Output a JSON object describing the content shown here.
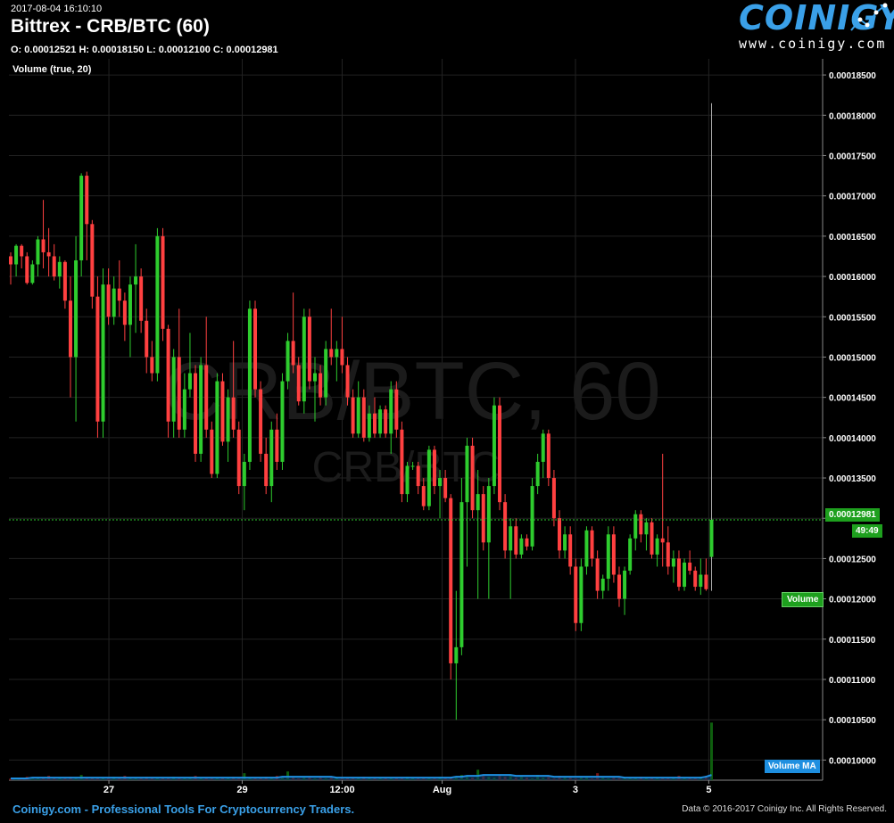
{
  "header": {
    "timestamp": "2017-08-04 16:10:10",
    "title": "Bittrex - CRB/BTC (60)",
    "ohlc": "O: 0.00012521 H: 0.00018150 L: 0.00012100 C: 0.00012981",
    "volume_label": "Volume (true, 20)"
  },
  "logo": {
    "word": "COINIGY",
    "url": "www.coinigy.com"
  },
  "watermark": {
    "line1": "CRB/BTC, 60",
    "line2": "CRB/BTC"
  },
  "badges": {
    "last_price": "0.00012981",
    "countdown": "49:49",
    "volume": "Volume",
    "volume_ma": "Volume MA"
  },
  "footer": {
    "left": "Coinigy.com - Professional Tools For Cryptocurrency Traders.",
    "right": "Data © 2016-2017 Coinigy Inc. All Rights Reserved."
  },
  "colors": {
    "up": "#2ecc2e",
    "down": "#ff4040",
    "grid": "#222222",
    "last_price_line": "#2ecc2e",
    "volume_ma": "#1e8fe0",
    "brand": "#3aa0e8"
  },
  "chart_data": {
    "type": "candlestick",
    "title": "Bittrex - CRB/BTC (60)",
    "y_axis": {
      "ticks": [
        "0.00018500",
        "0.00018000",
        "0.00017500",
        "0.00017000",
        "0.00016500",
        "0.00016000",
        "0.00015500",
        "0.00015000",
        "0.00014500",
        "0.00014000",
        "0.00013500",
        "0.00013000",
        "0.00012500",
        "0.00012000",
        "0.00011500",
        "0.00011000",
        "0.00010500",
        "0.00010000"
      ],
      "range": [
        9.75e-05,
        0.000187
      ],
      "position": "right"
    },
    "x_axis": {
      "ticks": [
        "27",
        "29",
        "12:00",
        "Aug",
        "3",
        "5"
      ],
      "tick_positions_hours": [
        36,
        84,
        120,
        156,
        204,
        252
      ]
    },
    "x_range_hours": [
      0,
      293
    ],
    "last": {
      "close": 0.00012981,
      "open": 0.00012521,
      "high": 0.0001815,
      "low": 0.000121
    },
    "series": [
      {
        "name": "CRB/BTC",
        "candles": [
          [
            0.0001625,
            0.000163,
            0.000159,
            0.0001615
          ],
          [
            0.0001615,
            0.000164,
            0.00016,
            0.0001638
          ],
          [
            0.0001638,
            0.000164,
            0.000161,
            0.0001625
          ],
          [
            0.0001625,
            0.000163,
            0.000159,
            0.0001592
          ],
          [
            0.0001592,
            0.000162,
            0.000159,
            0.0001615
          ],
          [
            0.0001615,
            0.000165,
            0.00016,
            0.0001646
          ],
          [
            0.0001646,
            0.0001695,
            0.000161,
            0.000163
          ],
          [
            0.000163,
            0.000166,
            0.00016,
            0.0001625
          ],
          [
            0.0001625,
            0.000164,
            0.0001595,
            0.00016
          ],
          [
            0.00016,
            0.0001625,
            0.0001585,
            0.0001618
          ],
          [
            0.0001618,
            0.000162,
            0.000156,
            0.000157
          ],
          [
            0.000157,
            0.00016,
            0.000145,
            0.00015
          ],
          [
            0.00015,
            0.000165,
            0.000142,
            0.000162
          ],
          [
            0.000162,
            0.0001728,
            0.00016,
            0.0001725
          ],
          [
            0.0001725,
            0.000173,
            0.000162,
            0.0001665
          ],
          [
            0.0001665,
            0.000167,
            0.000156,
            0.0001575
          ],
          [
            0.0001575,
            0.00016,
            0.00014,
            0.000142
          ],
          [
            0.000142,
            0.000161,
            0.00014,
            0.000159
          ],
          [
            0.000159,
            0.000161,
            0.000154,
            0.000155
          ],
          [
            0.000155,
            0.00016,
            0.000154,
            0.0001585
          ],
          [
            0.0001585,
            0.000162,
            0.000155,
            0.000157
          ],
          [
            0.000157,
            0.000158,
            0.000152,
            0.000154
          ],
          [
            0.000154,
            0.00016,
            0.00015,
            0.000159
          ],
          [
            0.000159,
            0.000164,
            0.000153,
            0.00016
          ],
          [
            0.00016,
            0.000161,
            0.000153,
            0.0001545
          ],
          [
            0.0001545,
            0.000156,
            0.000148,
            0.00015
          ],
          [
            0.00015,
            0.000152,
            0.000147,
            0.000148
          ],
          [
            0.000148,
            0.000166,
            0.000147,
            0.000165
          ],
          [
            0.000165,
            0.000166,
            0.000152,
            0.0001535
          ],
          [
            0.0001535,
            0.000154,
            0.00014,
            0.000142
          ],
          [
            0.000142,
            0.000151,
            0.00014,
            0.00015
          ],
          [
            0.00015,
            0.000156,
            0.00014,
            0.000141
          ],
          [
            0.000141,
            0.000148,
            0.00014,
            0.000146
          ],
          [
            0.000146,
            0.000153,
            0.000145,
            0.000148
          ],
          [
            0.000148,
            0.000149,
            0.000137,
            0.000138
          ],
          [
            0.000138,
            0.00015,
            0.000137,
            0.000149
          ],
          [
            0.000149,
            0.000155,
            0.00014,
            0.000141
          ],
          [
            0.000141,
            0.000142,
            0.000135,
            0.0001355
          ],
          [
            0.0001355,
            0.000148,
            0.000135,
            0.000147
          ],
          [
            0.000147,
            0.000148,
            0.000139,
            0.0001395
          ],
          [
            0.0001395,
            0.000146,
            0.000137,
            0.000145
          ],
          [
            0.000145,
            0.000152,
            0.00014,
            0.000141
          ],
          [
            0.000141,
            0.000142,
            0.000133,
            0.000134
          ],
          [
            0.000134,
            0.000138,
            0.000131,
            0.000137
          ],
          [
            0.000137,
            0.000157,
            0.000136,
            0.000156
          ],
          [
            0.000156,
            0.000157,
            0.000145,
            0.000146
          ],
          [
            0.000146,
            0.000147,
            0.000137,
            0.000138
          ],
          [
            0.000138,
            0.00014,
            0.000133,
            0.000134
          ],
          [
            0.000134,
            0.000142,
            0.000132,
            0.000141
          ],
          [
            0.000141,
            0.000143,
            0.000136,
            0.000137
          ],
          [
            0.000137,
            0.000148,
            0.000136,
            0.000147
          ],
          [
            0.000147,
            0.000153,
            0.000146,
            0.000152
          ],
          [
            0.000152,
            0.000158,
            0.000148,
            0.000149
          ],
          [
            0.000149,
            0.00015,
            0.000144,
            0.0001445
          ],
          [
            0.0001445,
            0.000156,
            0.000143,
            0.000155
          ],
          [
            0.000155,
            0.000156,
            0.000146,
            0.000147
          ],
          [
            0.000147,
            0.00015,
            0.000142,
            0.000148
          ],
          [
            0.000148,
            0.000149,
            0.000144,
            0.000145
          ],
          [
            0.000145,
            0.000152,
            0.000144,
            0.000151
          ],
          [
            0.000151,
            0.000156,
            0.000149,
            0.00015
          ],
          [
            0.00015,
            0.000152,
            0.000147,
            0.000151
          ],
          [
            0.000151,
            0.000155,
            0.000148,
            0.000149
          ],
          [
            0.000149,
            0.00015,
            0.000144,
            0.000145
          ],
          [
            0.000145,
            0.000146,
            0.00014,
            0.0001405
          ],
          [
            0.0001405,
            0.000147,
            0.00014,
            0.000145
          ],
          [
            0.000145,
            0.000146,
            0.0001395,
            0.00014
          ],
          [
            0.00014,
            0.000144,
            0.0001395,
            0.000143
          ],
          [
            0.000143,
            0.000145,
            0.00014,
            0.0001405
          ],
          [
            0.0001405,
            0.000144,
            0.00014,
            0.0001435
          ],
          [
            0.0001435,
            0.000144,
            0.00014,
            0.0001405
          ],
          [
            0.0001405,
            0.000147,
            0.000138,
            0.000146
          ],
          [
            0.000146,
            0.000147,
            0.00014,
            0.000141
          ],
          [
            0.000141,
            0.000142,
            0.000132,
            0.000133
          ],
          [
            0.000133,
            0.000137,
            0.000132,
            0.0001365
          ],
          [
            0.0001365,
            0.000137,
            0.000136,
            0.0001365
          ],
          [
            0.0001365,
            0.000137,
            0.000133,
            0.000134
          ],
          [
            0.000134,
            0.000135,
            0.000131,
            0.0001315
          ],
          [
            0.0001315,
            0.000139,
            0.000131,
            0.0001385
          ],
          [
            0.0001385,
            0.000139,
            0.000133,
            0.000134
          ],
          [
            0.000134,
            0.000136,
            0.00013,
            0.000135
          ],
          [
            0.000135,
            0.000136,
            0.000132,
            0.0001325
          ],
          [
            0.0001325,
            0.000133,
            0.00011,
            0.000112
          ],
          [
            0.000112,
            0.000121,
            0.000105,
            0.000114
          ],
          [
            0.000114,
            0.000135,
            0.000113,
            0.000132
          ],
          [
            0.000132,
            0.00014,
            0.000124,
            0.000139
          ],
          [
            0.000139,
            0.00014,
            0.00013,
            0.000131
          ],
          [
            0.000131,
            0.000136,
            0.00012,
            0.000133
          ],
          [
            0.000133,
            0.000134,
            0.000126,
            0.000127
          ],
          [
            0.000127,
            0.000135,
            0.00012,
            0.000134
          ],
          [
            0.000134,
            0.000145,
            0.000133,
            0.000144
          ],
          [
            0.000144,
            0.000145,
            0.000131,
            0.000132
          ],
          [
            0.000132,
            0.000133,
            0.000125,
            0.000126
          ],
          [
            0.000126,
            0.00013,
            0.00012,
            0.000129
          ],
          [
            0.000129,
            0.00013,
            0.000125,
            0.0001255
          ],
          [
            0.0001255,
            0.000128,
            0.000125,
            0.0001275
          ],
          [
            0.0001275,
            0.000128,
            0.000126,
            0.0001265
          ],
          [
            0.0001265,
            0.000135,
            0.000126,
            0.000134
          ],
          [
            0.000134,
            0.000138,
            0.000133,
            0.000137
          ],
          [
            0.000137,
            0.000141,
            0.000135,
            0.0001405
          ],
          [
            0.0001405,
            0.000141,
            0.000134,
            0.000135
          ],
          [
            0.000135,
            0.000136,
            0.000129,
            0.00013
          ],
          [
            0.00013,
            0.000131,
            0.000125,
            0.000126
          ],
          [
            0.000126,
            0.000129,
            0.000125,
            0.000128
          ],
          [
            0.000128,
            0.000129,
            0.000123,
            0.000124
          ],
          [
            0.000124,
            0.000125,
            0.000116,
            0.000117
          ],
          [
            0.000117,
            0.000125,
            0.000116,
            0.000124
          ],
          [
            0.000124,
            0.000129,
            0.000123,
            0.0001285
          ],
          [
            0.0001285,
            0.000129,
            0.000124,
            0.000125
          ],
          [
            0.000125,
            0.000126,
            0.00012,
            0.000121
          ],
          [
            0.000121,
            0.000123,
            0.00012,
            0.0001225
          ],
          [
            0.0001225,
            0.000129,
            0.000121,
            0.000128
          ],
          [
            0.000128,
            0.000129,
            0.000122,
            0.000123
          ],
          [
            0.000123,
            0.000124,
            0.000119,
            0.00012
          ],
          [
            0.00012,
            0.000124,
            0.000118,
            0.0001235
          ],
          [
            0.0001235,
            0.000128,
            0.000123,
            0.0001275
          ],
          [
            0.0001275,
            0.000131,
            0.000126,
            0.0001305
          ],
          [
            0.0001305,
            0.000131,
            0.000127,
            0.000128
          ],
          [
            0.000128,
            0.00013,
            0.000126,
            0.0001295
          ],
          [
            0.0001295,
            0.00013,
            0.000125,
            0.0001255
          ],
          [
            0.0001255,
            0.000128,
            0.000124,
            0.0001275
          ],
          [
            0.0001275,
            0.000138,
            0.000124,
            0.000127
          ],
          [
            0.000127,
            0.000129,
            0.000123,
            0.000124
          ],
          [
            0.000124,
            0.000126,
            0.000122,
            0.000125
          ],
          [
            0.000125,
            0.000126,
            0.000121,
            0.0001215
          ],
          [
            0.0001215,
            0.000125,
            0.000121,
            0.0001245
          ],
          [
            0.0001245,
            0.000126,
            0.000123,
            0.0001235
          ],
          [
            0.0001235,
            0.000124,
            0.000121,
            0.0001215
          ],
          [
            0.0001215,
            0.000125,
            0.0001205,
            0.000123
          ],
          [
            0.000123,
            0.000125,
            0.000121,
            0.0001212
          ],
          [
            0.0001252,
            0.0001815,
            0.000121,
            0.0001298
          ]
        ]
      }
    ],
    "volume": {
      "name": "Volume",
      "ma_name": "Volume MA",
      "values": [
        2,
        3,
        2,
        4,
        2,
        3,
        2,
        5,
        3,
        2,
        2,
        4,
        3,
        6,
        2,
        3,
        2,
        3,
        2,
        4,
        3,
        5,
        2,
        3,
        2,
        4,
        3,
        2,
        3,
        2,
        4,
        3,
        2,
        3,
        5,
        2,
        3,
        2,
        3,
        2,
        3,
        4,
        2,
        8,
        3,
        2,
        3,
        4,
        2,
        5,
        3,
        10,
        3,
        2,
        3,
        4,
        2,
        3,
        2,
        4,
        3,
        2,
        3,
        2,
        3,
        4,
        2,
        3,
        2,
        3,
        2,
        3,
        2,
        4,
        3,
        2,
        2,
        3,
        2,
        4,
        2,
        3,
        4,
        6,
        4,
        3,
        12,
        5,
        4,
        3,
        6,
        4,
        5,
        3,
        4,
        3,
        2,
        6,
        3,
        4,
        2,
        5,
        3,
        3,
        2,
        4,
        3,
        2,
        8,
        3,
        2,
        4,
        3,
        2,
        2,
        3,
        4,
        2,
        3,
        2,
        3,
        2,
        3,
        5,
        3,
        2,
        3,
        4,
        5,
        66
      ],
      "ma_values": [
        2,
        2,
        2,
        2,
        3,
        3,
        3,
        3,
        3,
        3,
        3,
        3,
        3,
        3,
        3,
        3,
        3,
        3,
        3,
        3,
        3,
        3,
        3,
        3,
        3,
        3,
        3,
        3,
        3,
        3,
        3,
        3,
        3,
        3,
        3,
        3,
        3,
        3,
        3,
        3,
        3,
        3,
        3,
        3,
        3,
        3,
        3,
        3,
        3,
        3,
        4,
        4,
        4,
        4,
        4,
        4,
        4,
        4,
        4,
        4,
        3,
        3,
        3,
        3,
        3,
        3,
        3,
        3,
        3,
        3,
        3,
        3,
        3,
        3,
        3,
        3,
        3,
        3,
        3,
        3,
        3,
        3,
        4,
        4,
        5,
        5,
        5,
        6,
        6,
        6,
        6,
        6,
        6,
        5,
        5,
        5,
        5,
        5,
        5,
        5,
        4,
        4,
        4,
        4,
        4,
        4,
        4,
        4,
        4,
        4,
        4,
        4,
        4,
        3,
        3,
        3,
        3,
        3,
        3,
        3,
        3,
        3,
        3,
        3,
        3,
        3,
        3,
        3,
        4,
        6
      ],
      "range_max": 240
    },
    "grid": true
  }
}
